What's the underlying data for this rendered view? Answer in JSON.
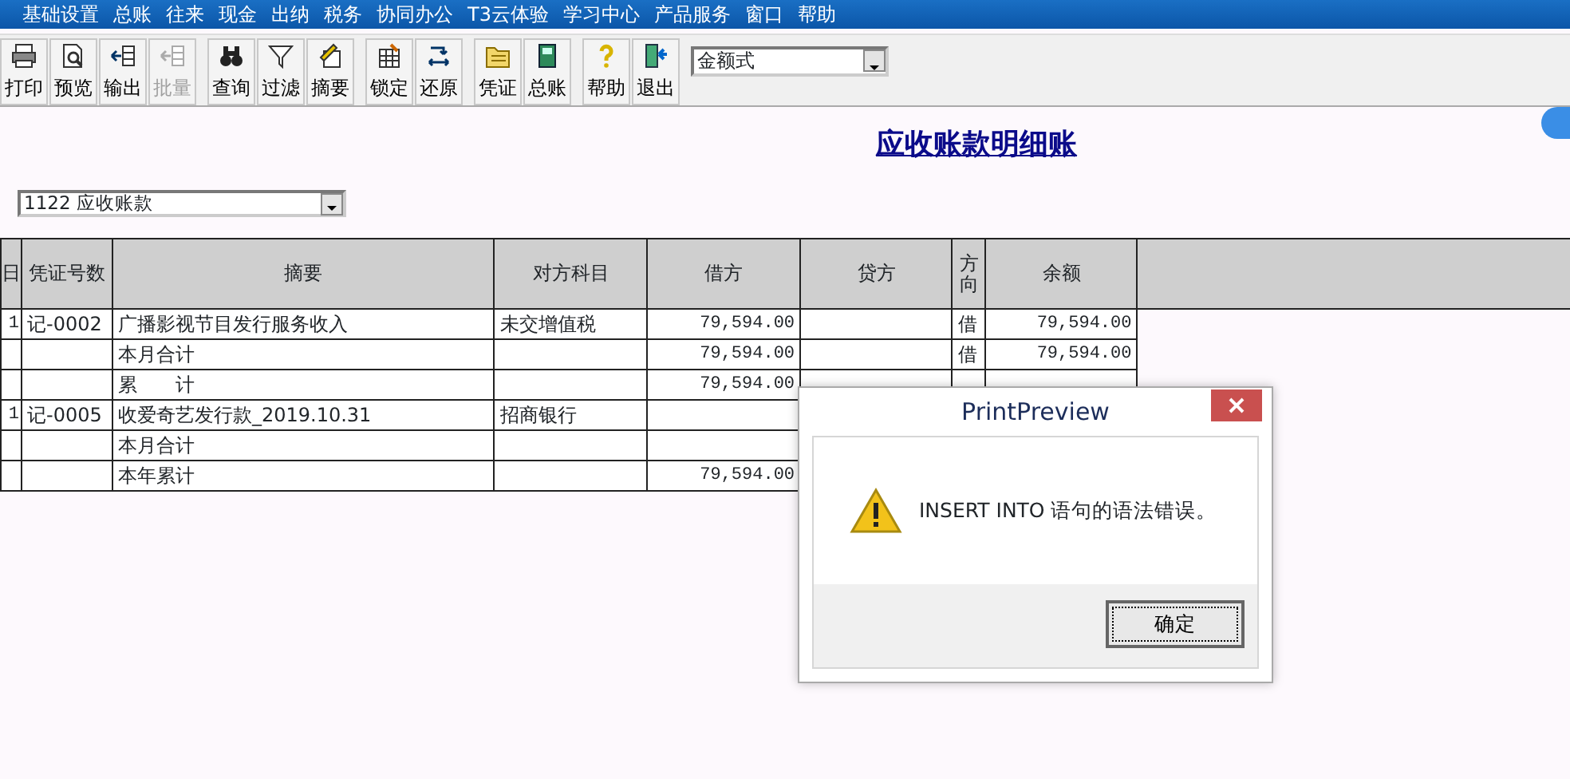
{
  "menu": [
    "基础设置",
    "总账",
    "往来",
    "现金",
    "出纳",
    "税务",
    "协同办公",
    "T3云体验",
    "学习中心",
    "产品服务",
    "窗口",
    "帮助"
  ],
  "toolbar": [
    [
      {
        "label": "打印",
        "disabled": false
      },
      {
        "label": "预览",
        "disabled": false
      },
      {
        "label": "输出",
        "disabled": false
      },
      {
        "label": "批量",
        "disabled": true
      }
    ],
    [
      {
        "label": "查询",
        "disabled": false
      },
      {
        "label": "过滤",
        "disabled": false
      },
      {
        "label": "摘要",
        "disabled": false
      }
    ],
    [
      {
        "label": "锁定",
        "disabled": false
      },
      {
        "label": "还原",
        "disabled": false
      }
    ],
    [
      {
        "label": "凭证",
        "disabled": false
      },
      {
        "label": "总账",
        "disabled": false
      }
    ],
    [
      {
        "label": "帮助",
        "disabled": false
      },
      {
        "label": "退出",
        "disabled": false
      }
    ]
  ],
  "format_select": {
    "value": "金额式"
  },
  "report_title": "应收账款明细账",
  "account_select": {
    "value": "1122 应收账款"
  },
  "table": {
    "columns": [
      "日",
      "凭证号数",
      "摘要",
      "对方科目",
      "借方",
      "贷方",
      "方向",
      "余额",
      ""
    ],
    "rows": [
      [
        "1",
        "记-0002",
        "广播影视节目发行服务收入",
        "未交增值税",
        "79,594.00",
        "",
        "借",
        "79,594.00"
      ],
      [
        "",
        "",
        "本月合计",
        "",
        "79,594.00",
        "",
        "借",
        "79,594.00"
      ],
      [
        "",
        "",
        "累　　计",
        "",
        "79,594.00",
        "",
        "",
        ""
      ],
      [
        "1",
        "记-0005",
        "收爱奇艺发行款_2019.10.31",
        "招商银行",
        "",
        "",
        "",
        ""
      ],
      [
        "",
        "",
        "本月合计",
        "",
        "",
        "",
        "",
        ""
      ],
      [
        "",
        "",
        "本年累计",
        "",
        "79,594.00",
        "",
        "",
        ""
      ]
    ]
  },
  "dialog": {
    "title": "PrintPreview",
    "message": "INSERT INTO 语句的语法错误。",
    "button": "确定"
  }
}
